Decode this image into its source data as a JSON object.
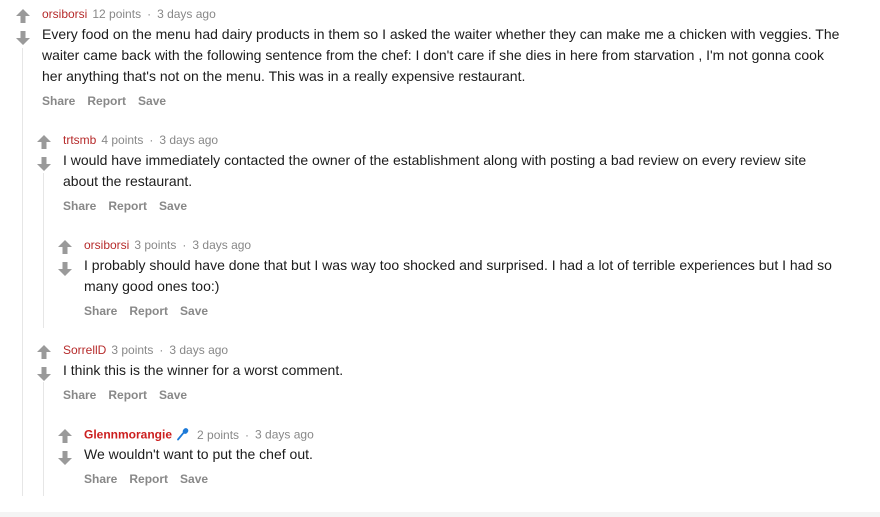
{
  "comments": [
    {
      "author": "orsiborsi",
      "points": "12 points",
      "separator": "·",
      "age": "3 days ago",
      "text": "Every food on the menu had dairy products in them so I asked the waiter whether they can make me a chicken with veggies. The waiter came back with the following sentence from the chef: I don't care if she dies in here from starvation , I'm not gonna cook her anything that's not on the menu. This was in a really expensive restaurant.",
      "actions": {
        "share": "Share",
        "report": "Report",
        "save": "Save"
      }
    },
    {
      "author": "trtsmb",
      "points": "4 points",
      "separator": "·",
      "age": "3 days ago",
      "text": "I would have immediately contacted the owner of the establishment along with posting a bad review on every review site about the restaurant.",
      "actions": {
        "share": "Share",
        "report": "Report",
        "save": "Save"
      }
    },
    {
      "author": "orsiborsi",
      "points": "3 points",
      "separator": "·",
      "age": "3 days ago",
      "text": "I probably should have done that but I was way too shocked and surprised. I had a lot of terrible experiences but I had so many good ones too:)",
      "actions": {
        "share": "Share",
        "report": "Report",
        "save": "Save"
      }
    },
    {
      "author": "SorrellD",
      "points": "3 points",
      "separator": "·",
      "age": "3 days ago",
      "text": "I think this is the winner for a worst comment.",
      "actions": {
        "share": "Share",
        "report": "Report",
        "save": "Save"
      }
    },
    {
      "author": "Glennmorangie",
      "flair_icon": "microphone-icon",
      "points": "2 points",
      "separator": "·",
      "age": "3 days ago",
      "text": "We wouldn't want to put the chef out.",
      "actions": {
        "share": "Share",
        "report": "Report",
        "save": "Save"
      }
    }
  ],
  "colors": {
    "author": "#b62b2b",
    "special_author": "#cc1f1f",
    "meta": "#888888",
    "arrow": "#9a9a9a",
    "mic": "#1d7ad8"
  }
}
